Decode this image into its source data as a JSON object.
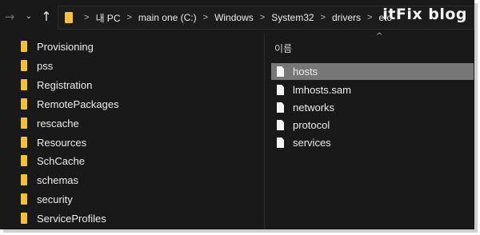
{
  "nav": {
    "back_glyph": "→",
    "dropdown_glyph": "⌄",
    "up_glyph": "↑"
  },
  "address": {
    "sep": ">",
    "crumbs": [
      "내 PC",
      "main one (C:)",
      "Windows",
      "System32",
      "drivers",
      "etc"
    ]
  },
  "watermark": "itFix blog",
  "tree": {
    "items": [
      {
        "label": "Provisioning"
      },
      {
        "label": "pss"
      },
      {
        "label": "Registration"
      },
      {
        "label": "RemotePackages"
      },
      {
        "label": "rescache"
      },
      {
        "label": "Resources"
      },
      {
        "label": "SchCache"
      },
      {
        "label": "schemas"
      },
      {
        "label": "security"
      },
      {
        "label": "ServiceProfiles"
      }
    ]
  },
  "files": {
    "sort_caret": "^",
    "column_header": "이름",
    "items": [
      {
        "label": "hosts",
        "selected": true
      },
      {
        "label": "lmhosts.sam",
        "selected": false
      },
      {
        "label": "networks",
        "selected": false
      },
      {
        "label": "protocol",
        "selected": false
      },
      {
        "label": "services",
        "selected": false
      }
    ]
  },
  "colors": {
    "background": "#191919",
    "folder": "#f2c03a",
    "selection": "#777777",
    "text": "#ececec"
  }
}
